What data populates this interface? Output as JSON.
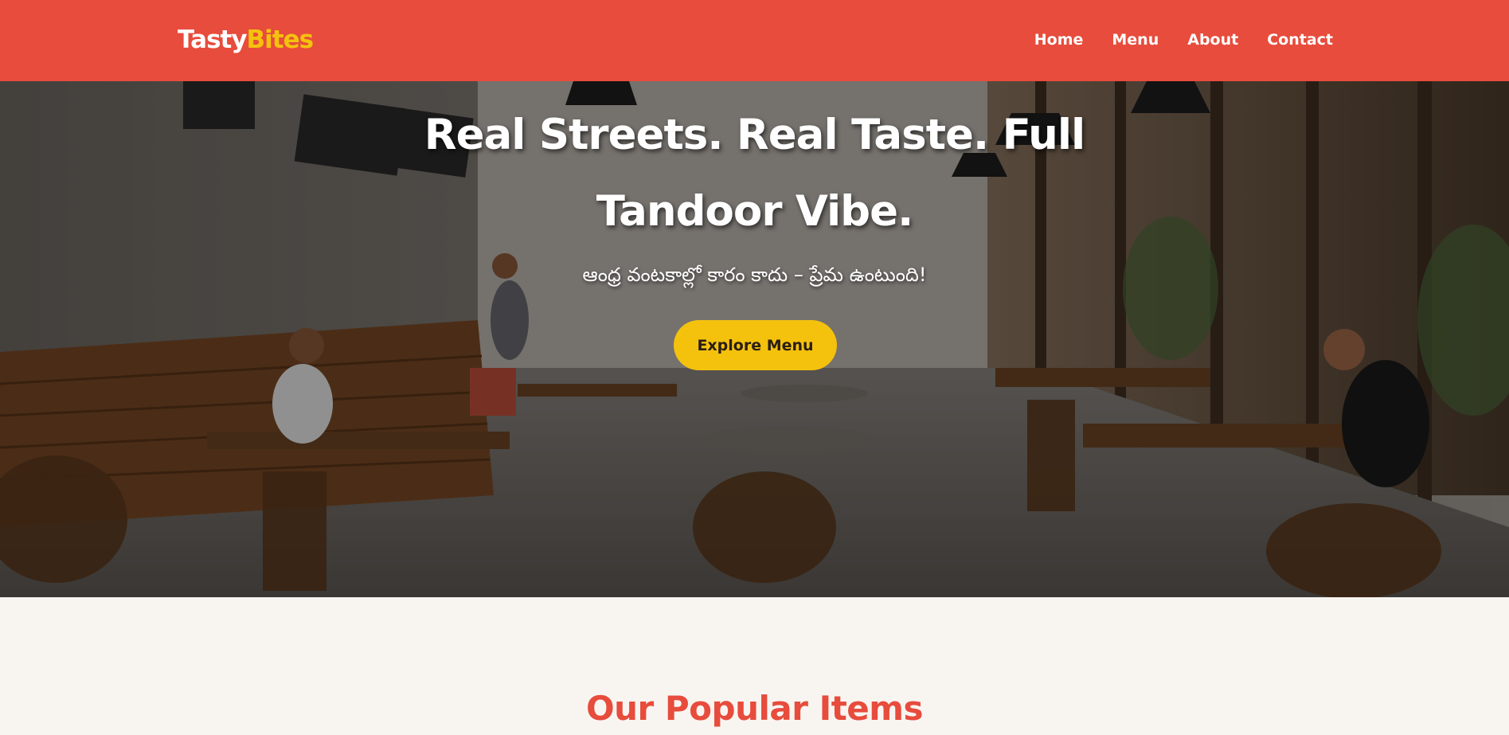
{
  "header": {
    "logo": {
      "part1": "Tasty",
      "part2": "Bites"
    },
    "nav": [
      "Home",
      "Menu",
      "About",
      "Contact"
    ]
  },
  "hero": {
    "title": "Real Streets. Real Taste. Full Tandoor Vibe.",
    "subtitle": "ఆంధ్ర వంటకాల్లో కారం కాదు – ప్రేమ ఉంటుంది!",
    "button_label": "Explore Menu",
    "background": "photo of a rustic cafe interior with wooden tables and chairs"
  },
  "popular": {
    "title": "Our Popular Items"
  },
  "colors": {
    "header_bg": "#e74c3c",
    "accent_yellow": "#f4c20d",
    "section_bg": "#f8f5f1",
    "heading_red": "#e74c3c"
  }
}
